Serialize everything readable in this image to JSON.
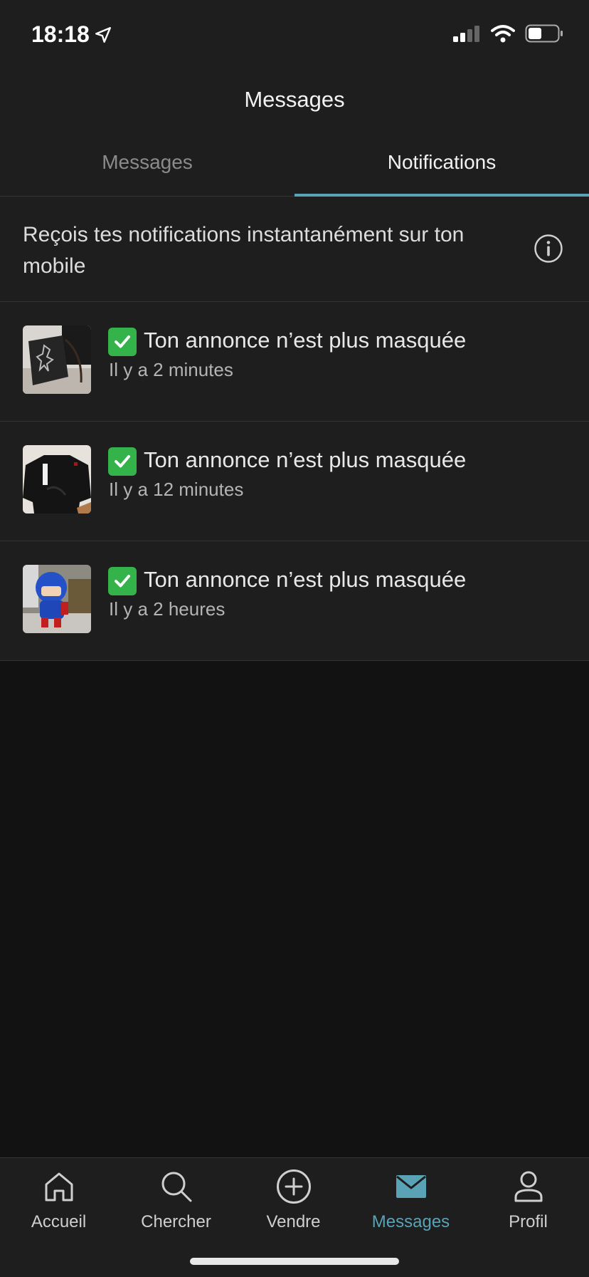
{
  "status_bar": {
    "time": "18:18"
  },
  "header": {
    "title": "Messages"
  },
  "tabs": [
    {
      "label": "Messages",
      "active": false
    },
    {
      "label": "Notifications",
      "active": true
    }
  ],
  "banner": {
    "text": "Reçois tes notifications instantanément sur ton mobile",
    "icon": "info-icon"
  },
  "notifications": [
    {
      "title": "Ton annonce n’est plus masquée",
      "time": "Il y a 2 minutes",
      "thumb": "black-bag-photo"
    },
    {
      "title": "Ton annonce n’est plus masquée",
      "time": "Il y a 12 minutes",
      "thumb": "black-sweatshirt-photo"
    },
    {
      "title": "Ton annonce n’est plus masquée",
      "time": "Il y a 2 heures",
      "thumb": "blue-figure-photo"
    }
  ],
  "tabbar": [
    {
      "label": "Accueil",
      "icon": "home-icon",
      "active": false
    },
    {
      "label": "Chercher",
      "icon": "search-icon",
      "active": false
    },
    {
      "label": "Vendre",
      "icon": "plus-circle-icon",
      "active": false
    },
    {
      "label": "Messages",
      "icon": "mail-icon",
      "active": true
    },
    {
      "label": "Profil",
      "icon": "user-icon",
      "active": false
    }
  ],
  "colors": {
    "accent": "#5aa2b5",
    "background": "#121212",
    "surface": "#1e1e1e",
    "check": "#33b34a"
  }
}
